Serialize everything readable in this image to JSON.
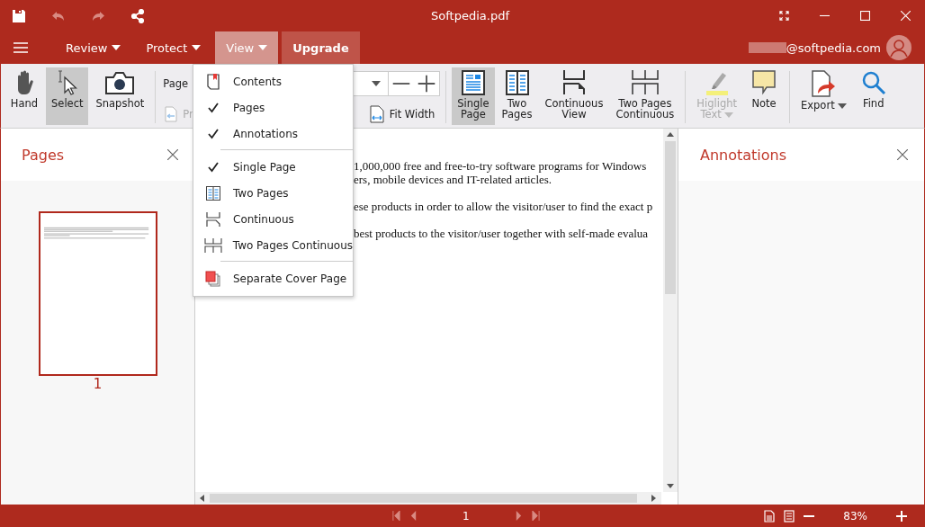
{
  "window": {
    "title": "Softpedia.pdf"
  },
  "menu_bar": {
    "tabs": [
      {
        "label": "Review",
        "kind": "dropdown",
        "selected": false
      },
      {
        "label": "Protect",
        "kind": "dropdown",
        "selected": false
      },
      {
        "label": "View",
        "kind": "dropdown",
        "selected": true
      },
      {
        "label": "Upgrade",
        "kind": "upgrade",
        "selected": false
      }
    ],
    "account": "@softpedia.com"
  },
  "toolbar": {
    "groups": [
      [
        {
          "label": "Hand",
          "selected": false,
          "disabled": false,
          "dropdown": false
        },
        {
          "label": "Select",
          "selected": true,
          "disabled": false,
          "dropdown": false
        },
        {
          "label": "Snapshot",
          "selected": false,
          "disabled": false,
          "dropdown": false
        }
      ],
      [
        {
          "label": "Single\nPage",
          "selected": true,
          "disabled": false,
          "dropdown": false
        },
        {
          "label": "Two\nPages",
          "selected": false,
          "disabled": false,
          "dropdown": false
        },
        {
          "label": "Continuous\nView",
          "selected": false,
          "disabled": false,
          "dropdown": false
        },
        {
          "label": "Two Pages\nContinuous",
          "selected": false,
          "disabled": false,
          "dropdown": false
        }
      ],
      [
        {
          "label": "Higlight\nText",
          "selected": false,
          "disabled": true,
          "dropdown": true
        },
        {
          "label": "Note",
          "selected": false,
          "disabled": false,
          "dropdown": false
        }
      ],
      [
        {
          "label": "Export",
          "selected": false,
          "disabled": false,
          "dropdown": true
        },
        {
          "label": "Find",
          "selected": false,
          "disabled": false,
          "dropdown": false
        }
      ]
    ],
    "page_label": "Page",
    "previous_button": "Pr",
    "fit_width": "Fit Width"
  },
  "view_menu": {
    "groups": [
      [
        {
          "label": "Contents",
          "checked": false
        },
        {
          "label": "Pages",
          "checked": true
        },
        {
          "label": "Annotations",
          "checked": true
        }
      ],
      [
        {
          "label": "Single Page",
          "checked": true
        },
        {
          "label": "Two Pages",
          "checked": false
        },
        {
          "label": "Continuous",
          "checked": false
        },
        {
          "label": "Two Pages Continuous",
          "checked": false
        }
      ],
      [
        {
          "label": "Separate Cover Page",
          "checked": false
        }
      ]
    ]
  },
  "pages_panel": {
    "title": "Pages",
    "thumbnails": [
      {
        "number": "1",
        "selected": true
      }
    ]
  },
  "document": {
    "paragraphs": [
      [
        "1,000,000 free and free-to-try software programs for Windows",
        "ers, mobile devices and IT-related articles."
      ],
      [
        "ese products in order to allow the visitor/user to find the exact p"
      ],
      [
        "best products to the visitor/user together with self-made evalua"
      ]
    ]
  },
  "annotations_panel": {
    "title": "Annotations"
  },
  "status_bar": {
    "page": "1",
    "zoom": "83%"
  }
}
